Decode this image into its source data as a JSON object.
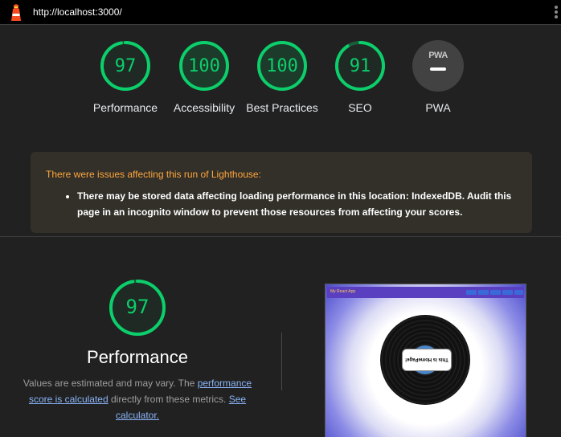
{
  "browser": {
    "url": "http://localhost:3000/"
  },
  "scores": [
    {
      "label": "Performance",
      "value": "97"
    },
    {
      "label": "Accessibility",
      "value": "100"
    },
    {
      "label": "Best Practices",
      "value": "100"
    },
    {
      "label": "SEO",
      "value": "91"
    }
  ],
  "pwa": {
    "label": "PWA",
    "badge_text": "PWA"
  },
  "warning": {
    "title": "There were issues affecting this run of Lighthouse:",
    "items": [
      "There may be stored data affecting loading performance in this location: IndexedDB. Audit this page in an incognito window to prevent those resources from affecting your scores."
    ]
  },
  "performance": {
    "score": "97",
    "title": "Performance",
    "desc_prefix": "Values are estimated and may vary. The ",
    "link1": "performance score is calculated",
    "desc_middle": " directly from these metrics. ",
    "link2": "See calculator."
  },
  "screenshot": {
    "brand": "My React App",
    "record_label": "This is HomePage!"
  },
  "colors": {
    "pass": "#0cce6b",
    "warning": "#ffa53b",
    "link": "#8ab4f8"
  }
}
